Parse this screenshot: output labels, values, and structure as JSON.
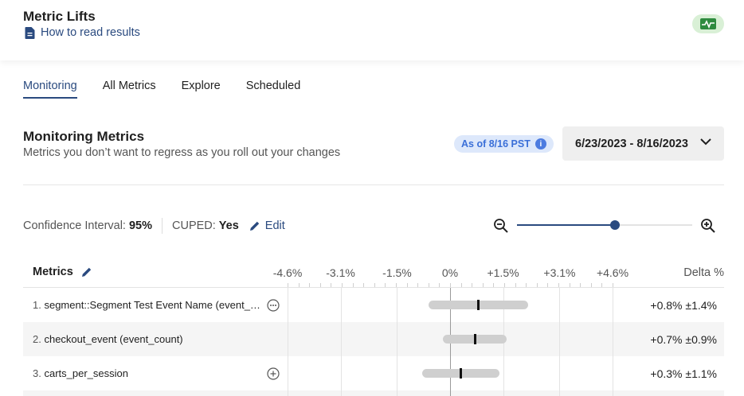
{
  "header": {
    "title": "Metric Lifts",
    "how_to_link": "How to read results",
    "pulse_icon": "pulse-icon"
  },
  "tabs": [
    {
      "label": "Monitoring",
      "active": true
    },
    {
      "label": "All Metrics",
      "active": false
    },
    {
      "label": "Explore",
      "active": false
    },
    {
      "label": "Scheduled",
      "active": false
    }
  ],
  "section": {
    "title": "Monitoring Metrics",
    "subtitle": "Metrics you don’t want to regress as you roll out your changes",
    "as_of": "As of 8/16 PST",
    "date_range": "6/23/2023 - 8/16/2023"
  },
  "settings": {
    "ci_label": "Confidence Interval:",
    "ci_value": "95%",
    "cuped_label": "CUPED:",
    "cuped_value": "Yes",
    "edit_label": "Edit",
    "zoom_level": 0.56
  },
  "table": {
    "metrics_header": "Metrics",
    "delta_header": "Delta %",
    "axis_ticks": [
      "-4.6%",
      "-3.1%",
      "-1.5%",
      "0%",
      "+1.5%",
      "+3.1%",
      "+4.6%"
    ],
    "axis_values": [
      -4.6,
      -3.1,
      -1.5,
      0,
      1.5,
      3.1,
      4.6
    ],
    "rows": [
      {
        "index": "1.",
        "name": "segment::Segment Test Event Name (event_co...",
        "delta": "+0.8% ±1.4%",
        "point": 0.8,
        "ci": 1.4,
        "icon": "more-options-icon"
      },
      {
        "index": "2.",
        "name": "checkout_event (event_count)",
        "delta": "+0.7% ±0.9%",
        "point": 0.7,
        "ci": 0.9,
        "icon": ""
      },
      {
        "index": "3.",
        "name": "carts_per_session",
        "delta": "+0.3% ±1.1%",
        "point": 0.3,
        "ci": 1.1,
        "icon": "add-circle-icon"
      }
    ]
  }
}
